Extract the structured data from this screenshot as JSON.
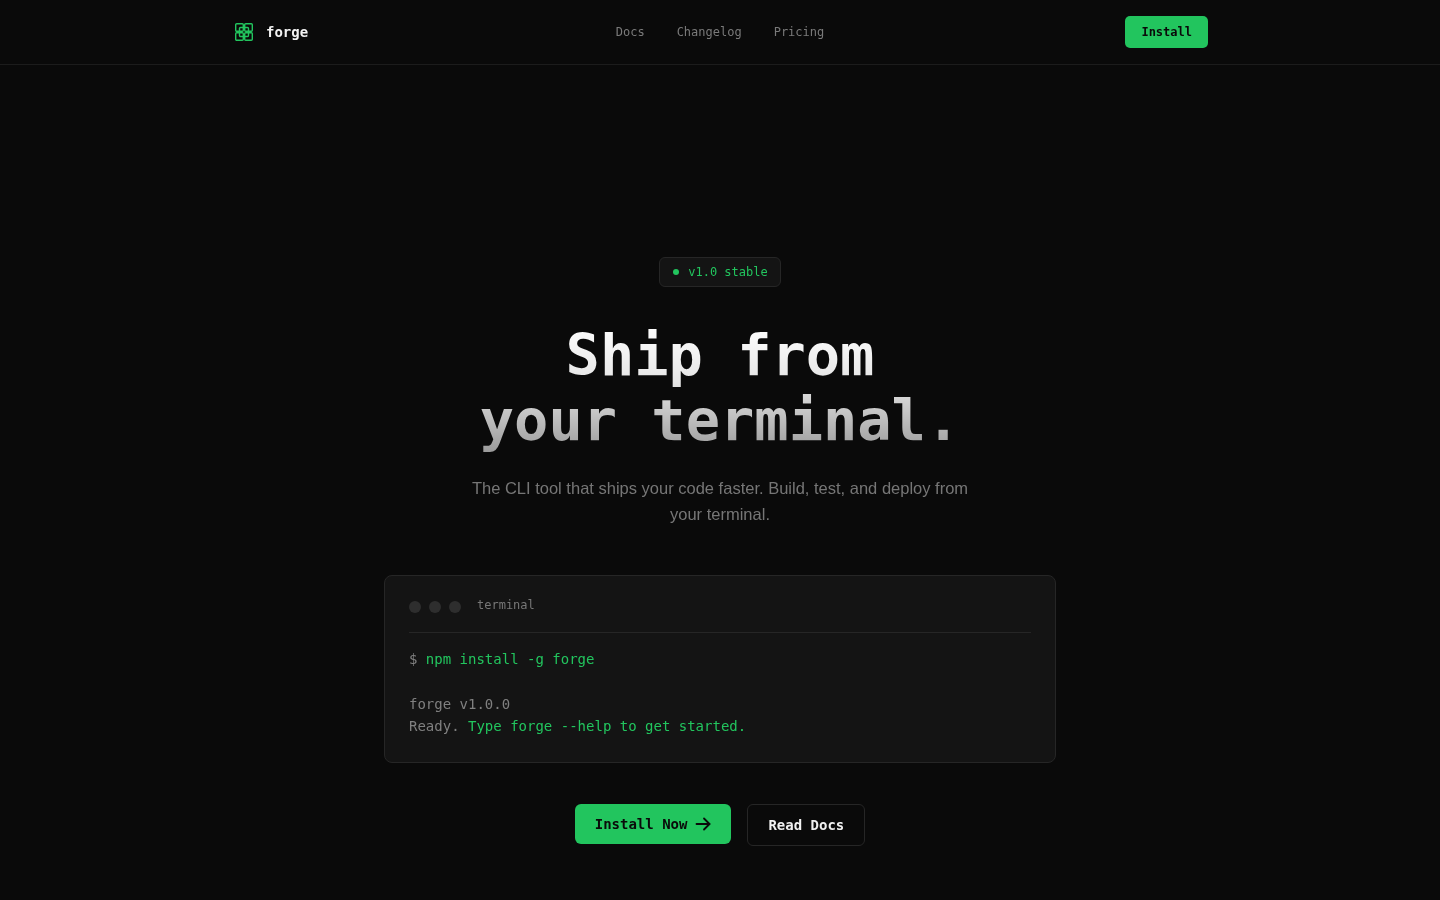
{
  "nav": {
    "brand": "forge",
    "links": [
      {
        "label": "Docs"
      },
      {
        "label": "Changelog"
      },
      {
        "label": "Pricing"
      }
    ],
    "cta": "Install"
  },
  "hero": {
    "badge": "v1.0 stable",
    "title_lines": [
      "Ship from",
      "your terminal."
    ],
    "subtitle": "The CLI tool that ships your code faster. Build, test, and deploy from your terminal.",
    "terminal": {
      "title": "terminal",
      "groups": [
        [
          {
            "segments": [
              {
                "kind": "prompt",
                "text": "$ "
              },
              {
                "kind": "command",
                "text": "npm install -g forge"
              }
            ]
          }
        ],
        [
          {
            "segments": [
              {
                "kind": "output",
                "text": "forge v1.0.0"
              }
            ]
          },
          {
            "segments": [
              {
                "kind": "output",
                "text": "Ready. "
              },
              {
                "kind": "highlight",
                "text": "Type forge --help to get started."
              }
            ]
          }
        ]
      ]
    },
    "buttons": [
      {
        "kind": "primary",
        "label": "Install Now"
      },
      {
        "kind": "secondary",
        "label": "Read Docs"
      }
    ]
  }
}
